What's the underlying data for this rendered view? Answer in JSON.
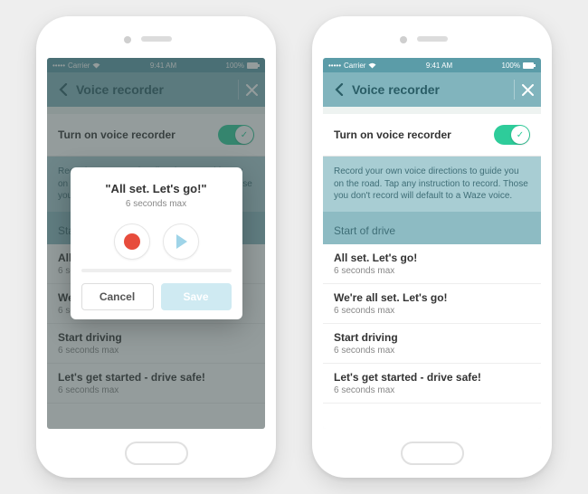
{
  "status": {
    "carrier": "Carrier",
    "time": "9:41 AM",
    "battery": "100%"
  },
  "nav": {
    "title": "Voice recorder"
  },
  "toggle": {
    "label": "Turn on voice recorder"
  },
  "info": "Record your own voice directions to guide you on the road. Tap any instruction to record. Those you don't record will default to a Waze voice.",
  "section": {
    "header": "Start of drive"
  },
  "items": [
    {
      "title": "All set. Let's go!",
      "sub": "6 seconds max"
    },
    {
      "title": "We're all set. Let's go!",
      "sub": "6 seconds max"
    },
    {
      "title": "Start driving",
      "sub": "6 seconds max"
    },
    {
      "title": "Let's get started - drive safe!",
      "sub": "6 seconds max"
    }
  ],
  "modal": {
    "title": "\"All set. Let's go!\"",
    "sub": "6 seconds max",
    "cancel": "Cancel",
    "save": "Save"
  }
}
